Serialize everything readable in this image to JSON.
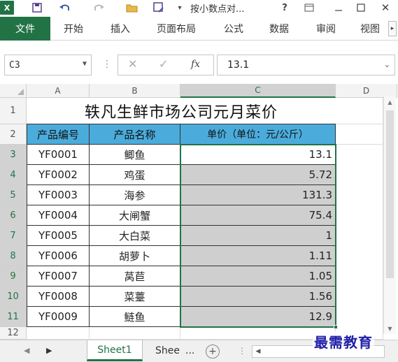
{
  "titlebar": {
    "logo": "X",
    "doc_title": "按小数点对...",
    "help": "?",
    "icons": [
      "excel-logo",
      "save-icon",
      "undo-icon",
      "redo-icon",
      "open-folder-icon",
      "save-as-icon",
      "help-icon",
      "ribbon-display-icon",
      "minimize-icon",
      "maximize-icon",
      "close-icon"
    ]
  },
  "ribbon": {
    "file_tab": "文件",
    "tabs": [
      "开始",
      "插入",
      "页面布局",
      "公式",
      "数据",
      "审阅",
      "视图"
    ]
  },
  "formula_bar": {
    "name_box": "C3",
    "fx": "fx",
    "value": "13.1"
  },
  "columns": [
    "A",
    "B",
    "C",
    "D"
  ],
  "rows": [
    "1",
    "2",
    "3",
    "4",
    "5",
    "6",
    "7",
    "8",
    "9",
    "10",
    "11",
    "12"
  ],
  "sheet": {
    "title": "轶凡生鲜市场公司元月菜价",
    "headers": [
      "产品编号",
      "产品名称",
      "单价（单位：元/公斤）"
    ],
    "data": [
      {
        "code": "YF0001",
        "name": "鲫鱼",
        "price": "13.1"
      },
      {
        "code": "YF0002",
        "name": "鸡蛋",
        "price": "5.72"
      },
      {
        "code": "YF0003",
        "name": "海参",
        "price": "131.3"
      },
      {
        "code": "YF0004",
        "name": "大闸蟹",
        "price": "75.4"
      },
      {
        "code": "YF0005",
        "name": "大白菜",
        "price": "1"
      },
      {
        "code": "YF0006",
        "name": "胡萝卜",
        "price": "1.11"
      },
      {
        "code": "YF0007",
        "name": "莴苣",
        "price": "1.05"
      },
      {
        "code": "YF0008",
        "name": "菜薹",
        "price": "1.56"
      },
      {
        "code": "YF0009",
        "name": "鲢鱼",
        "price": "12.9"
      }
    ]
  },
  "sheet_tabs": {
    "active": "Sheet1",
    "other": "Shee",
    "more": "...",
    "add": "+"
  },
  "watermark": "最需教育",
  "colors": {
    "excel_green": "#217346",
    "header_fill": "#4bacdc",
    "selection_fill": "#cfcfcf"
  }
}
